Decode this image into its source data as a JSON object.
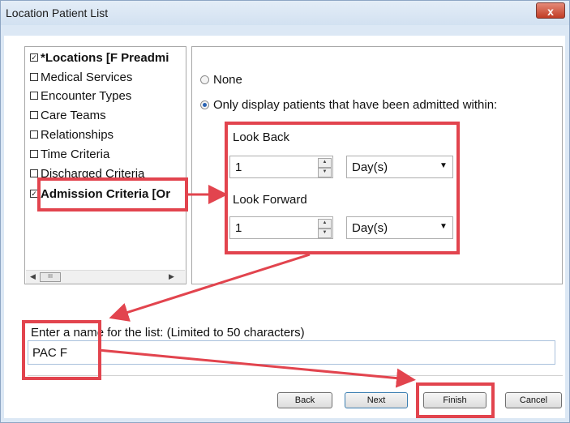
{
  "window": {
    "title": "Location Patient List",
    "close_glyph": "x"
  },
  "nav": {
    "items": [
      {
        "label": "*Locations [F Preadmi",
        "checked": true,
        "bold": true
      },
      {
        "label": "Medical Services",
        "checked": false,
        "bold": false
      },
      {
        "label": "Encounter Types",
        "checked": false,
        "bold": false
      },
      {
        "label": "Care Teams",
        "checked": false,
        "bold": false
      },
      {
        "label": "Relationships",
        "checked": false,
        "bold": false
      },
      {
        "label": "Time Criteria",
        "checked": false,
        "bold": false
      },
      {
        "label": "Discharged Criteria",
        "checked": false,
        "bold": false
      },
      {
        "label": "Admission Criteria [Or",
        "checked": true,
        "bold": true
      }
    ],
    "scroll_thumb_glyph": "III"
  },
  "options": {
    "radio_none": "None",
    "radio_admitted": "Only display patients that have been admitted within:",
    "selected": "admitted",
    "look_back": {
      "label": "Look Back",
      "value": "1",
      "unit": "Day(s)"
    },
    "look_forward": {
      "label": "Look Forward",
      "value": "1",
      "unit": "Day(s)"
    }
  },
  "name_section": {
    "label": "Enter a name for the list: (Limited to 50 characters)",
    "value": "PAC F"
  },
  "buttons": {
    "back": "Back",
    "next": "Next",
    "finish": "Finish",
    "cancel": "Cancel"
  },
  "annotation": {
    "color": "#e2444e"
  },
  "colors": {
    "title_bar": "#d2e1f1",
    "close_button": "#c13c25",
    "radio_selected": "#2a63b3"
  }
}
